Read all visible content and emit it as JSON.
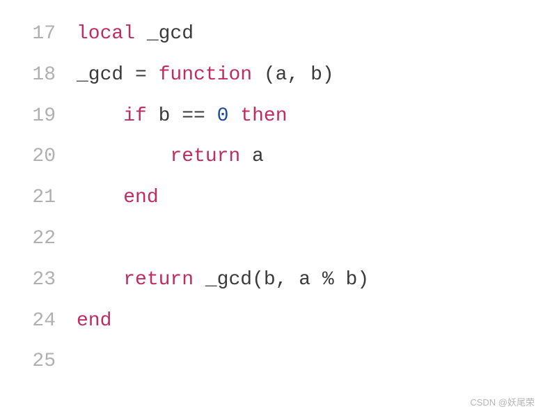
{
  "lines": [
    {
      "num": "17",
      "indent": "",
      "tokens": [
        {
          "cls": "kw",
          "t": "local"
        },
        {
          "cls": "id",
          "t": " _gcd"
        }
      ]
    },
    {
      "num": "18",
      "indent": "",
      "tokens": [
        {
          "cls": "id",
          "t": "_gcd "
        },
        {
          "cls": "op",
          "t": "= "
        },
        {
          "cls": "kw",
          "t": "function"
        },
        {
          "cls": "punct",
          "t": " ("
        },
        {
          "cls": "id",
          "t": "a"
        },
        {
          "cls": "punct",
          "t": ", "
        },
        {
          "cls": "id",
          "t": "b"
        },
        {
          "cls": "punct",
          "t": ")"
        }
      ]
    },
    {
      "num": "19",
      "indent": "    ",
      "tokens": [
        {
          "cls": "kw",
          "t": "if"
        },
        {
          "cls": "id",
          "t": " b "
        },
        {
          "cls": "op",
          "t": "== "
        },
        {
          "cls": "num",
          "t": "0"
        },
        {
          "cls": "kw",
          "t": " then"
        }
      ]
    },
    {
      "num": "20",
      "indent": "        ",
      "tokens": [
        {
          "cls": "kw",
          "t": "return"
        },
        {
          "cls": "id",
          "t": " a"
        }
      ]
    },
    {
      "num": "21",
      "indent": "    ",
      "tokens": [
        {
          "cls": "kw",
          "t": "end"
        }
      ]
    },
    {
      "num": "22",
      "indent": "",
      "tokens": []
    },
    {
      "num": "23",
      "indent": "    ",
      "tokens": [
        {
          "cls": "kw",
          "t": "return"
        },
        {
          "cls": "id",
          "t": " _gcd"
        },
        {
          "cls": "punct",
          "t": "("
        },
        {
          "cls": "id",
          "t": "b"
        },
        {
          "cls": "punct",
          "t": ", "
        },
        {
          "cls": "id",
          "t": "a "
        },
        {
          "cls": "op",
          "t": "% "
        },
        {
          "cls": "id",
          "t": "b"
        },
        {
          "cls": "punct",
          "t": ")"
        }
      ]
    },
    {
      "num": "24",
      "indent": "",
      "tokens": [
        {
          "cls": "kw",
          "t": "end"
        }
      ]
    },
    {
      "num": "25",
      "indent": "",
      "tokens": []
    }
  ],
  "watermark": "CSDN @妖尾荣"
}
